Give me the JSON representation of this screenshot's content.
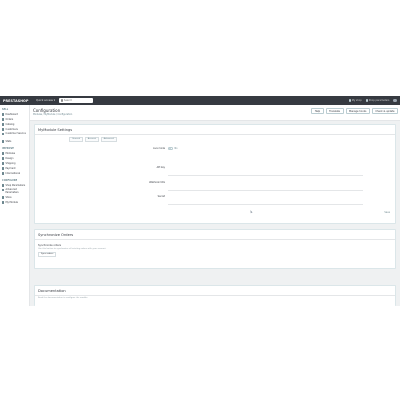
{
  "header": {
    "logo": "PRESTASHOP",
    "quick_access": "Quick access ▾",
    "search_placeholder": "Search",
    "view_shop": "My shop",
    "shop_params": "Shop parameters"
  },
  "sidebar": {
    "sections": [
      {
        "title": "SELL",
        "items": [
          "Dashboard",
          "Orders",
          "Catalog",
          "Customers",
          "Customer Service",
          "Stats"
        ]
      },
      {
        "title": "IMPROVE",
        "items": [
          "Modules",
          "Design",
          "Shipping",
          "Payment",
          "International"
        ]
      },
      {
        "title": "CONFIGURE",
        "items": [
          "Shop Parameters",
          "Advanced Parameters",
          "Store",
          "My Module"
        ]
      }
    ]
  },
  "page": {
    "title": "Configuration",
    "breadcrumb": "Modules / MyModule / Configuration",
    "toolbar": [
      "Help",
      "Translate",
      "Manage hooks",
      "Check & update"
    ]
  },
  "settings": {
    "title": "MyModule Settings",
    "tabs": [
      "General",
      "Account",
      "Advanced"
    ],
    "fields": [
      {
        "label": "Live mode",
        "type": "toggle",
        "value": "No"
      },
      {
        "label": "API key",
        "type": "text",
        "value": ""
      },
      {
        "label": "Webhook URL",
        "type": "text",
        "value": ""
      },
      {
        "label": "Secret",
        "type": "text",
        "value": ""
      }
    ],
    "save": "Save"
  },
  "sync": {
    "title": "Synchronize Orders",
    "label": "Synchronize orders",
    "help": "Use this button to synchronize all existing orders with your account.",
    "button": "Sync orders"
  },
  "docs": {
    "title": "Documentation",
    "text": "Read the documentation to configure the module."
  }
}
